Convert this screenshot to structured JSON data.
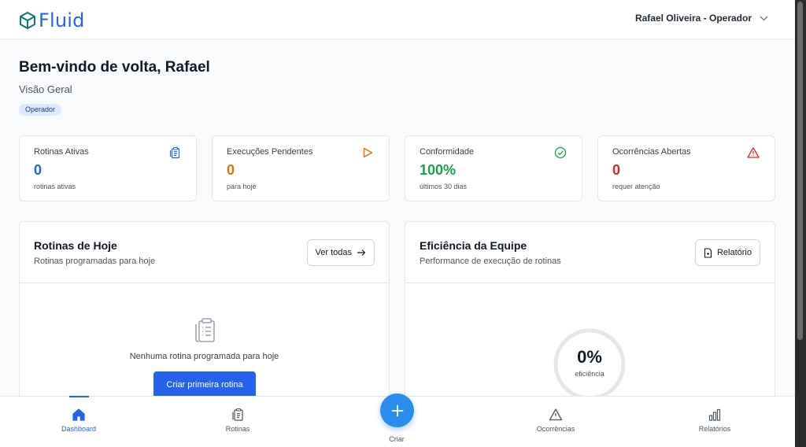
{
  "app": {
    "name": "Fluid",
    "brand_color": "#2563eb"
  },
  "header": {
    "user_label": "Rafael Oliveira - Operador"
  },
  "welcome": {
    "title": "Bem-vindo de volta, Rafael",
    "subtitle": "Visão Geral",
    "role_badge": "Operador"
  },
  "stats": [
    {
      "label": "Rotinas Ativas",
      "value": "0",
      "foot": "rotinas ativas",
      "icon": "clipboard-icon",
      "color": "#2563eb"
    },
    {
      "label": "Execuções Pendentes",
      "value": "0",
      "foot": "para hoje",
      "icon": "play-icon",
      "color": "#d97706"
    },
    {
      "label": "Conformidade",
      "value": "100%",
      "foot": "últimos 30 dias",
      "icon": "check-circle-icon",
      "color": "#16a34a"
    },
    {
      "label": "Ocorrências Abertas",
      "value": "0",
      "foot": "requer atenção",
      "icon": "alert-triangle-icon",
      "color": "#dc2626"
    }
  ],
  "routines_panel": {
    "title": "Rotinas de Hoje",
    "subtitle": "Rotinas programadas para hoje",
    "view_all_label": "Ver todas",
    "empty_text": "Nenhuma rotina programada para hoje",
    "create_label": "Criar primeira rotina"
  },
  "efficiency_panel": {
    "title": "Eficiência da Equipe",
    "subtitle": "Performance de execução de rotinas",
    "report_label": "Relatório",
    "gauge_value": "0%",
    "gauge_label": "eficiência",
    "gauge_fraction": 0
  },
  "bottom_nav": {
    "items": [
      {
        "label": "Dashboard",
        "icon": "home-icon",
        "active": true
      },
      {
        "label": "Rotinas",
        "icon": "clipboard-icon",
        "active": false
      },
      {
        "label": "Ocorrências",
        "icon": "alert-triangle-icon",
        "active": false
      },
      {
        "label": "Relatórios",
        "icon": "bar-chart-icon",
        "active": false
      }
    ],
    "create_label": "Criar"
  }
}
